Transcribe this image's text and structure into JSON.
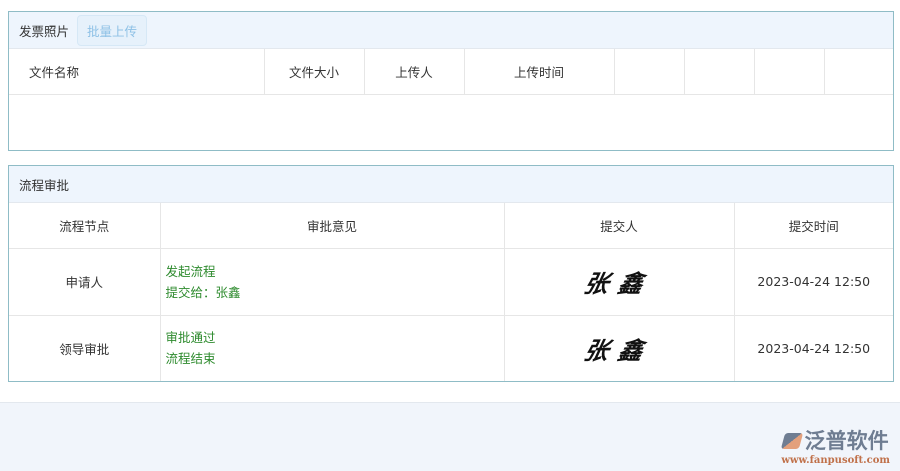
{
  "invoice": {
    "title": "发票照片",
    "upload_button": "批量上传",
    "columns": [
      "文件名称",
      "文件大小",
      "上传人",
      "上传时间",
      "",
      "",
      "",
      ""
    ]
  },
  "workflow": {
    "title": "流程审批",
    "columns": [
      "流程节点",
      "审批意见",
      "提交人",
      "提交时间"
    ],
    "rows": [
      {
        "node": "申请人",
        "opinion_line1": "发起流程",
        "opinion_line2": "提交给：张鑫",
        "submitter": "张鑫",
        "time": "2023-04-24 12:50"
      },
      {
        "node": "领导审批",
        "opinion_line1": "审批通过",
        "opinion_line2": "流程结束",
        "submitter": "张鑫",
        "time": "2023-04-24 12:50"
      }
    ]
  },
  "logo": {
    "name": "泛普软件",
    "url": "www.fanpusoft.com"
  }
}
